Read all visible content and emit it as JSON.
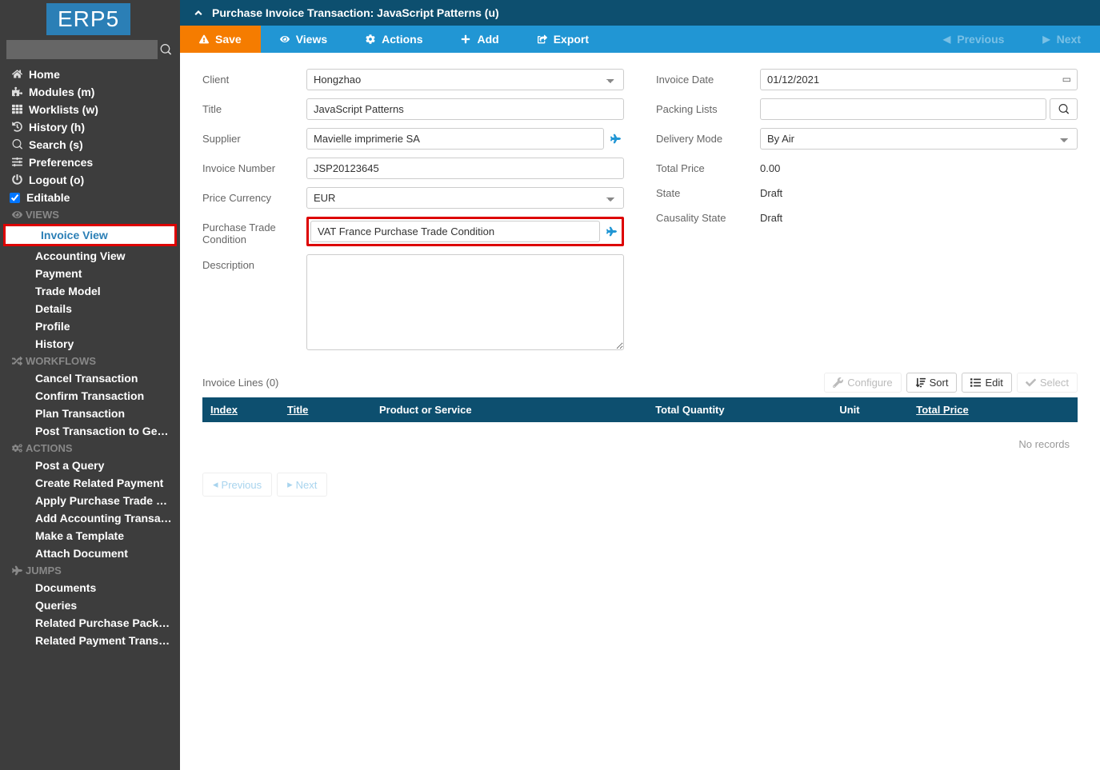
{
  "logo": "ERP5",
  "nav": {
    "home": "Home",
    "modules": "Modules (m)",
    "worklists": "Worklists (w)",
    "history": "History (h)",
    "search": "Search (s)",
    "preferences": "Preferences",
    "logout": "Logout (o)",
    "editable": "Editable"
  },
  "sections": {
    "views": "VIEWS",
    "workflows": "WORKFLOWS",
    "actions": "ACTIONS",
    "jumps": "JUMPS"
  },
  "views": {
    "invoice": "Invoice View",
    "accounting": "Accounting View",
    "payment": "Payment",
    "trade": "Trade Model",
    "details": "Details",
    "profile": "Profile",
    "history": "History"
  },
  "workflows": {
    "cancel": "Cancel Transaction",
    "confirm": "Confirm Transaction",
    "plan": "Plan Transaction",
    "post": "Post Transaction to General L..."
  },
  "actions": {
    "query": "Post a Query",
    "payment": "Create Related Payment",
    "apply": "Apply Purchase Trade Conditi...",
    "addline": "Add Accounting Transaction L...",
    "template": "Make a Template",
    "attach": "Attach Document"
  },
  "jumps": {
    "docs": "Documents",
    "queries": "Queries",
    "packing": "Related Purchase Packing List",
    "payment": "Related Payment Transaction"
  },
  "breadcrumb": "Purchase Invoice Transaction: JavaScript Patterns (u)",
  "toolbar": {
    "save": "Save",
    "views": "Views",
    "actions": "Actions",
    "add": "Add",
    "export": "Export",
    "previous": "Previous",
    "next": "Next"
  },
  "form": {
    "client_label": "Client",
    "client": "Hongzhao",
    "title_label": "Title",
    "title": "JavaScript Patterns",
    "supplier_label": "Supplier",
    "supplier": "Mavielle imprimerie SA",
    "invoice_number_label": "Invoice Number",
    "invoice_number": "JSP20123645",
    "currency_label": "Price Currency",
    "currency": "EUR",
    "ptc_label": "Purchase Trade Condition",
    "ptc": "VAT France Purchase Trade Condition",
    "description_label": "Description",
    "invoice_date_label": "Invoice Date",
    "invoice_date": "01/12/2021",
    "packing_label": "Packing Lists",
    "delivery_label": "Delivery Mode",
    "delivery": "By Air",
    "total_label": "Total Price",
    "total": "0.00",
    "state_label": "State",
    "state": "Draft",
    "causality_label": "Causality State",
    "causality": "Draft"
  },
  "table": {
    "title": "Invoice Lines (0)",
    "configure": "Configure",
    "sort": "Sort",
    "edit": "Edit",
    "select": "Select",
    "cols": {
      "index": "Index",
      "title": "Title",
      "product": "Product or Service",
      "qty": "Total Quantity",
      "unit": "Unit",
      "price": "Total Price"
    },
    "empty": "No records",
    "prev": "Previous",
    "next": "Next"
  }
}
